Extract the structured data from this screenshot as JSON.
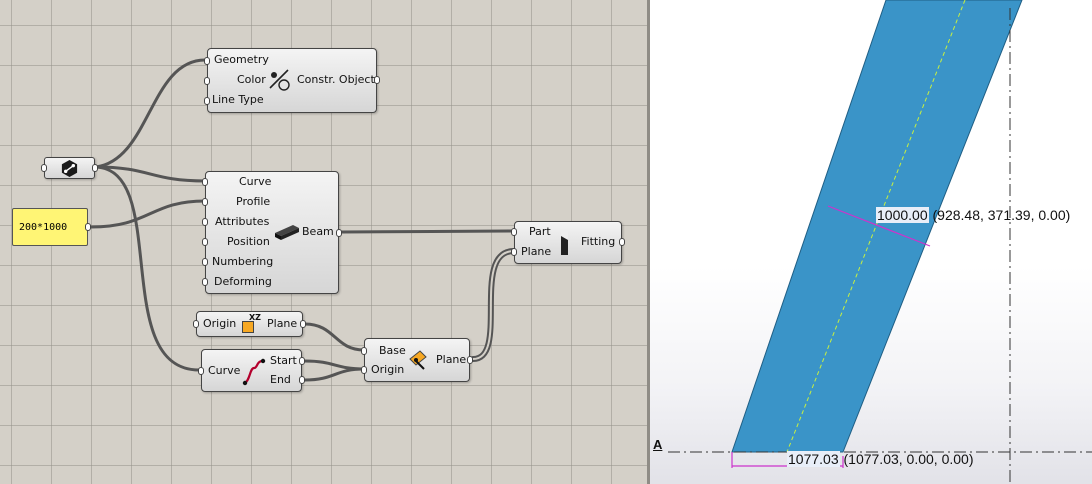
{
  "colors": {
    "canvas_bg": "#d4d0c8",
    "component_border": "#444444",
    "wire": "#555555",
    "panel_bg": "#fff575",
    "beam_fill": "#3a94c8",
    "beam_edge": "#1f5e84",
    "centerline": "#c8f040",
    "dim_line": "#cc33cc"
  },
  "components": {
    "display": {
      "inputs": [
        "Geometry",
        "Color",
        "Line Type"
      ],
      "output": "Constr. Object",
      "icon": "construction-object-icon"
    },
    "param": {
      "icon": "geometry-param-icon"
    },
    "panel": {
      "text": "200*1000"
    },
    "beam": {
      "inputs": [
        "Curve",
        "Profile",
        "Attributes",
        "Position",
        "Numbering",
        "Deforming"
      ],
      "output": "Beam",
      "icon": "beam-icon"
    },
    "fitting": {
      "inputs": [
        "Part",
        "Plane"
      ],
      "output": "Fitting",
      "icon": "fitting-icon"
    },
    "xzplane": {
      "input": "Origin",
      "output": "Plane",
      "icon_text": "XZ"
    },
    "endpoints": {
      "input": "Curve",
      "outputs": [
        "Start",
        "End"
      ],
      "icon": "curve-endpoints-icon"
    },
    "constructplane": {
      "inputs": [
        "Base",
        "Origin"
      ],
      "output": "Plane",
      "icon": "plane-icon"
    }
  },
  "viewport": {
    "dim_upper": {
      "value": "1000.00",
      "coords": "(928.48, 371.39, 0.00)"
    },
    "dim_lower": {
      "value": "1077.03",
      "coords": "(1077.03, 0.00, 0.00)"
    },
    "grid_label": "A"
  }
}
